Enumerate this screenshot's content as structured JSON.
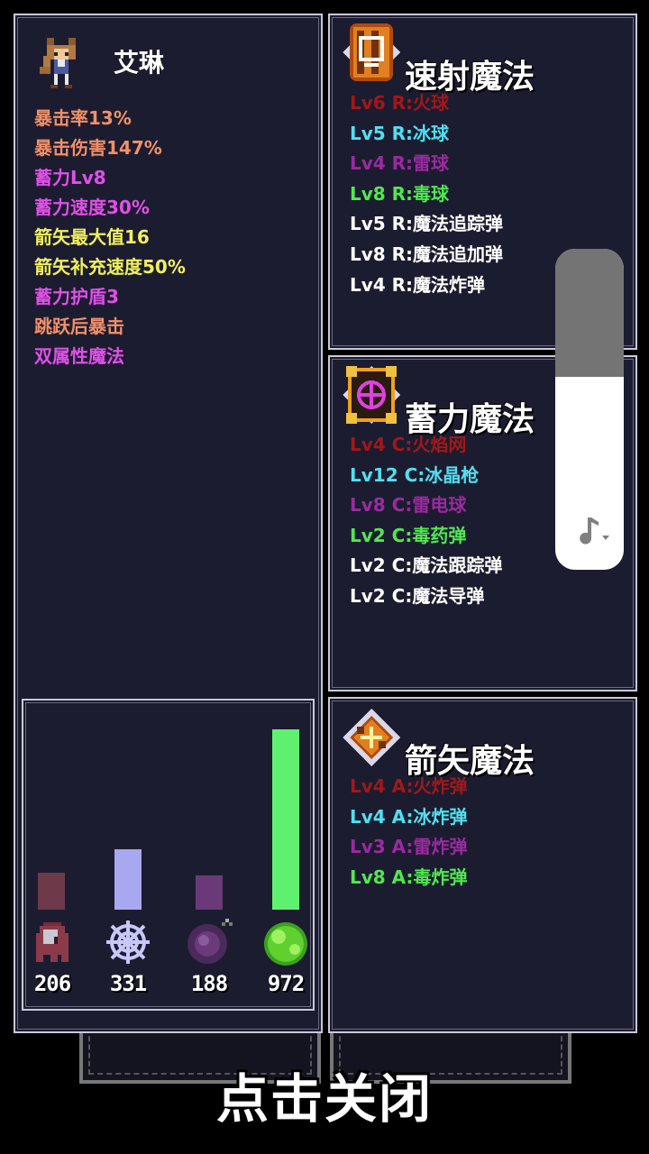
{
  "character": {
    "name": "艾琳",
    "stats": [
      {
        "text": "暴击率13%",
        "color": "#f0906a"
      },
      {
        "text": "暴击伤害147%",
        "color": "#f0906a"
      },
      {
        "text": "蓄力Lv8",
        "color": "#e050e8"
      },
      {
        "text": "蓄力速度30%",
        "color": "#e050e8"
      },
      {
        "text": "箭矢最大值16",
        "color": "#f0f060"
      },
      {
        "text": "箭矢补充速度50%",
        "color": "#f0f060"
      },
      {
        "text": "蓄力护盾3",
        "color": "#e050e8"
      },
      {
        "text": "跳跃后暴击",
        "color": "#f0906a"
      },
      {
        "text": "双属性魔法",
        "color": "#e050e8"
      }
    ]
  },
  "resources": {
    "items": [
      {
        "icon": "fire-ghost-icon",
        "value": "206",
        "level": 0.205,
        "bar_color": "#6e3a4a"
      },
      {
        "icon": "snowflake-icon",
        "value": "331",
        "level": 0.33,
        "bar_color": "#a8a8f0"
      },
      {
        "icon": "thunder-orb-icon",
        "value": "188",
        "level": 0.19,
        "bar_color": "#6a3a78"
      },
      {
        "icon": "poison-slime-icon",
        "value": "972",
        "level": 0.99,
        "bar_color": "#60f070"
      }
    ]
  },
  "sections": [
    {
      "title": "速射魔法",
      "icon": "rapid-fire-scroll-icon",
      "spells": [
        {
          "text": "Lv6 R:火球",
          "color": "#a01818"
        },
        {
          "text": "Lv5 R:冰球",
          "color": "#50e0f0"
        },
        {
          "text": "Lv4 R:雷球",
          "color": "#9a2aa0"
        },
        {
          "text": "Lv8 R:毒球",
          "color": "#50e850"
        },
        {
          "text": "Lv5 R:魔法追踪弹",
          "color": "#ffffff"
        },
        {
          "text": "Lv8 R:魔法追加弹",
          "color": "#ffffff"
        },
        {
          "text": "Lv4 R:魔法炸弹",
          "color": "#ffffff"
        }
      ]
    },
    {
      "title": "蓄力魔法",
      "icon": "charge-crosshair-icon",
      "spells": [
        {
          "text": "Lv4 C:火焰网",
          "color": "#a01818"
        },
        {
          "text": "Lv12 C:冰晶枪",
          "color": "#50e0f0"
        },
        {
          "text": "Lv8 C:雷电球",
          "color": "#9a2aa0"
        },
        {
          "text": "Lv2 C:毒药弹",
          "color": "#50e850"
        },
        {
          "text": "Lv2 C:魔法跟踪弹",
          "color": "#ffffff"
        },
        {
          "text": "Lv2 C:魔法导弹",
          "color": "#ffffff"
        }
      ]
    },
    {
      "title": "箭矢魔法",
      "icon": "arrow-cross-icon",
      "spells": [
        {
          "text": "Lv4 A:火炸弹",
          "color": "#a01818"
        },
        {
          "text": "Lv4 A:冰炸弹",
          "color": "#50e0f0"
        },
        {
          "text": "Lv3 A:雷炸弹",
          "color": "#9a2aa0"
        },
        {
          "text": "Lv8 A:毒炸弹",
          "color": "#50e850"
        }
      ]
    }
  ],
  "volume": {
    "level": 0.6,
    "icon": "music-note-icon"
  },
  "close_label": "点击关闭"
}
